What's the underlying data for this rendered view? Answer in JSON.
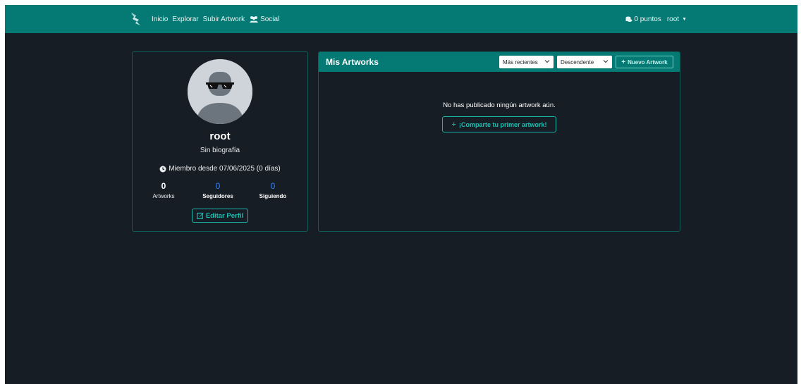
{
  "navbar": {
    "logo_icon": "pen-nib-logo-icon",
    "links": [
      {
        "label": "Inicio"
      },
      {
        "label": "Explorar"
      },
      {
        "label": "Subir Artwork"
      },
      {
        "label": "Social",
        "icon": "users-icon"
      }
    ],
    "points": "0 puntos",
    "points_icon": "coins-icon",
    "user": "root"
  },
  "profile": {
    "username": "root",
    "bio": "Sin biografía",
    "member_since": "Miembro desde 07/06/2025 (0 días)",
    "stats": [
      {
        "value": "0",
        "label": "Artworks"
      },
      {
        "value": "0",
        "label": "Seguidores"
      },
      {
        "value": "0",
        "label": "Siguiendo"
      }
    ],
    "edit_label": "Editar Perfil"
  },
  "artworks": {
    "title": "Mis Artworks",
    "sort_selected": "Más recientes",
    "order_selected": "Descendente",
    "new_label": "Nuevo Artwork",
    "empty_message": "No has publicado ningún artwork aún.",
    "share_label": "¡Comparte tu primer artwork!"
  },
  "colors": {
    "primary": "#057a74",
    "background": "#171d24",
    "link_blue": "#2f86ff",
    "accent": "#18b5a8"
  }
}
